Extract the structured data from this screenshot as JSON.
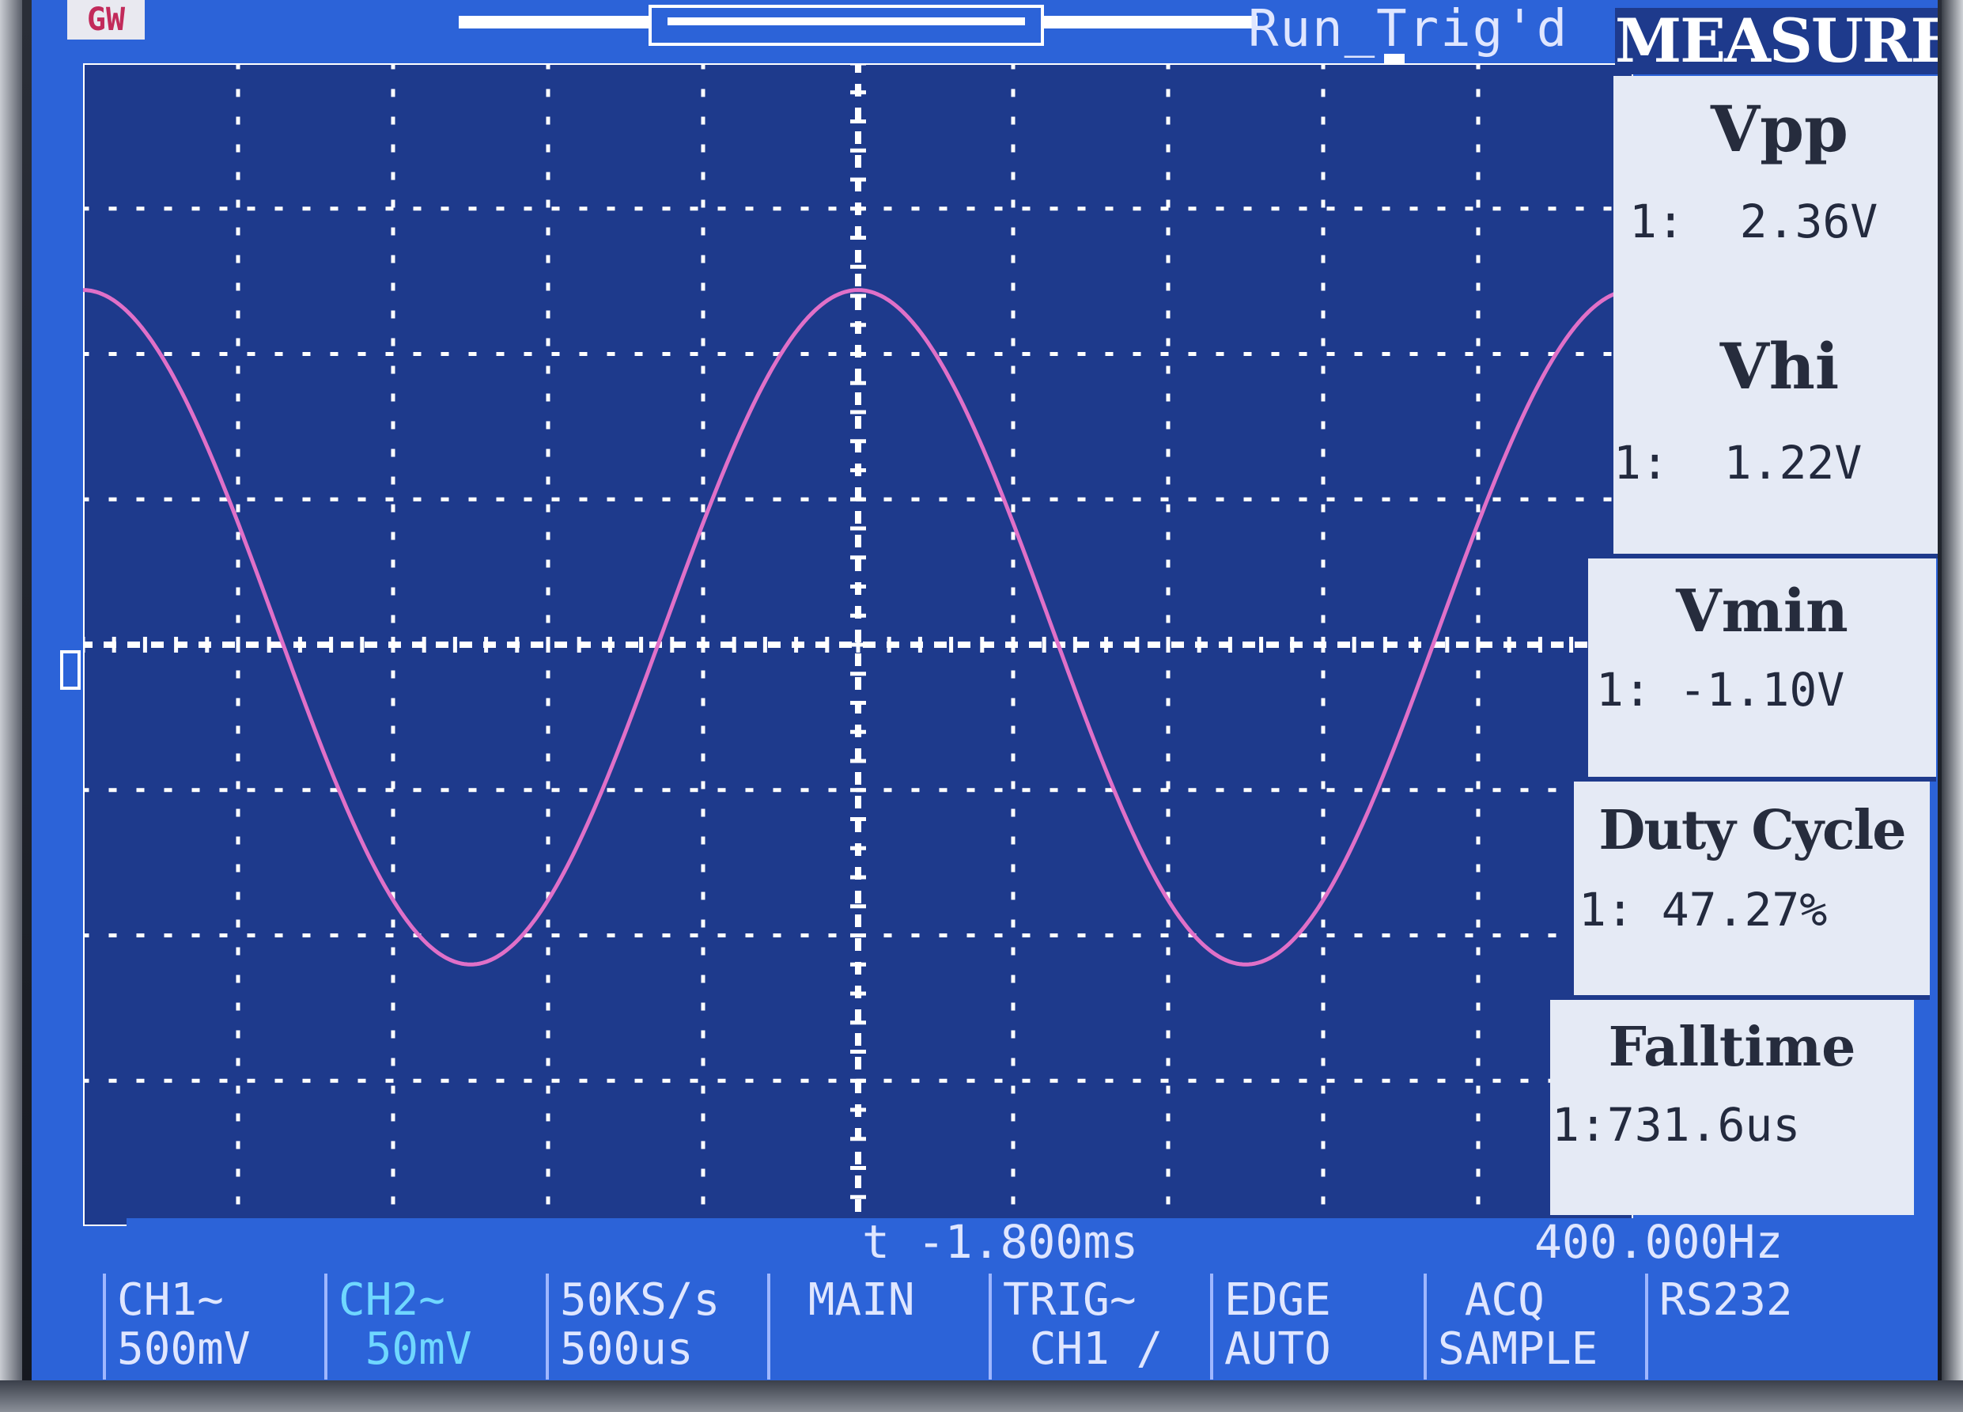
{
  "header": {
    "logo": "GW",
    "status": "Run_Trig'd"
  },
  "measure_panel": {
    "title": "MEASURE",
    "items": [
      {
        "label": "Vpp",
        "value": "1:  2.36V"
      },
      {
        "label": "Vhi",
        "value": "1:  1.22V"
      },
      {
        "label": "Vmin",
        "value": "1: -1.10V"
      },
      {
        "label": "Duty Cycle",
        "value": "1: 47.27%"
      },
      {
        "label": "Falltime",
        "value": "1:731.6us"
      }
    ]
  },
  "info_line": {
    "time_offset": "t -1.800ms",
    "frequency": "400.000Hz"
  },
  "softkeys": [
    {
      "line1": "CH1∼",
      "line2": "500mV"
    },
    {
      "line1": "CH2∼",
      "line2": " 50mV"
    },
    {
      "line1": "50KS/s",
      "line2": "500us"
    },
    {
      "line1": " MAIN",
      "line2": ""
    },
    {
      "line1": "TRIG∼",
      "line2": " CH1 /"
    },
    {
      "line1": "EDGE",
      "line2": "AUTO"
    },
    {
      "line1": " ACQ",
      "line2": "SAMPLE"
    },
    {
      "line1": "RS232",
      "line2": ""
    }
  ],
  "colors": {
    "screen": "#2c63d8",
    "graticule_bg": "#1e3a8c",
    "trace": "#e070c8",
    "panel": "#e5eaf5"
  },
  "waveform": {
    "channel": "CH1",
    "vmax": 1.22,
    "vmin": -1.1,
    "frequency_hz": 400,
    "volts_per_div": 0.5,
    "time_per_div_us": 500
  }
}
